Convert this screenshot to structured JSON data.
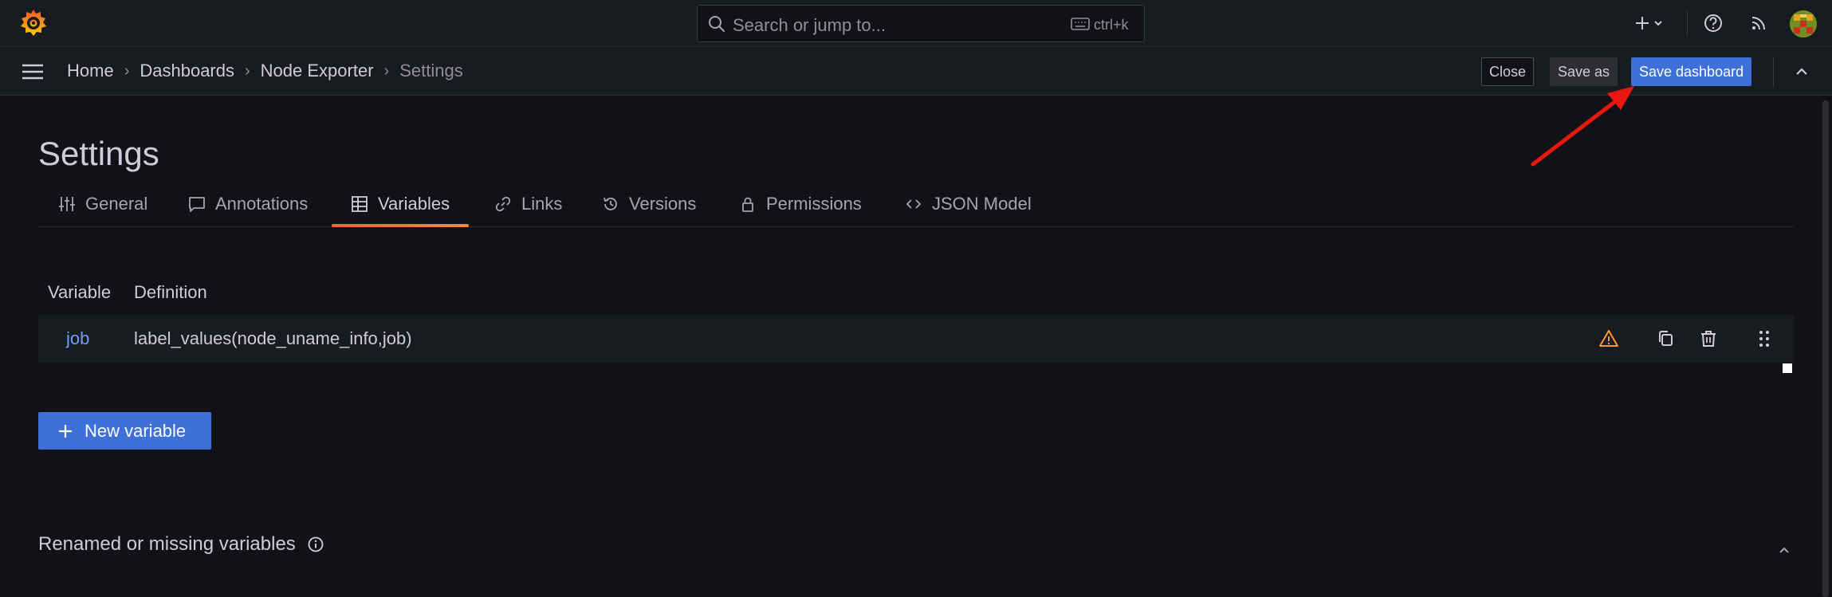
{
  "topbar": {
    "search": {
      "placeholder": "Search or jump to...",
      "shortcut": "ctrl+k"
    }
  },
  "breadcrumbs": [
    {
      "label": "Home"
    },
    {
      "label": "Dashboards"
    },
    {
      "label": "Node Exporter"
    },
    {
      "label": "Settings"
    }
  ],
  "actions": {
    "close_label": "Close",
    "save_as_label": "Save as",
    "save_dashboard_label": "Save dashboard"
  },
  "page": {
    "title": "Settings",
    "tabs": [
      {
        "label": "General",
        "icon": "sliders-icon"
      },
      {
        "label": "Annotations",
        "icon": "comment-icon"
      },
      {
        "label": "Variables",
        "icon": "table-icon",
        "active": true
      },
      {
        "label": "Links",
        "icon": "link-icon"
      },
      {
        "label": "Versions",
        "icon": "history-icon"
      },
      {
        "label": "Permissions",
        "icon": "lock-icon"
      },
      {
        "label": "JSON Model",
        "icon": "code-icon"
      }
    ]
  },
  "variables_table": {
    "headers": {
      "variable": "Variable",
      "definition": "Definition"
    },
    "rows": [
      {
        "name": "job",
        "definition": "label_values(node_uname_info,job)"
      }
    ]
  },
  "new_variable_label": "New variable",
  "missing_section": {
    "title": "Renamed or missing variables"
  },
  "colors": {
    "accent_blue": "#3d71d9",
    "link_blue": "#6e9fff",
    "warning_orange": "#ff9830",
    "annotation_red": "#e8170f"
  }
}
